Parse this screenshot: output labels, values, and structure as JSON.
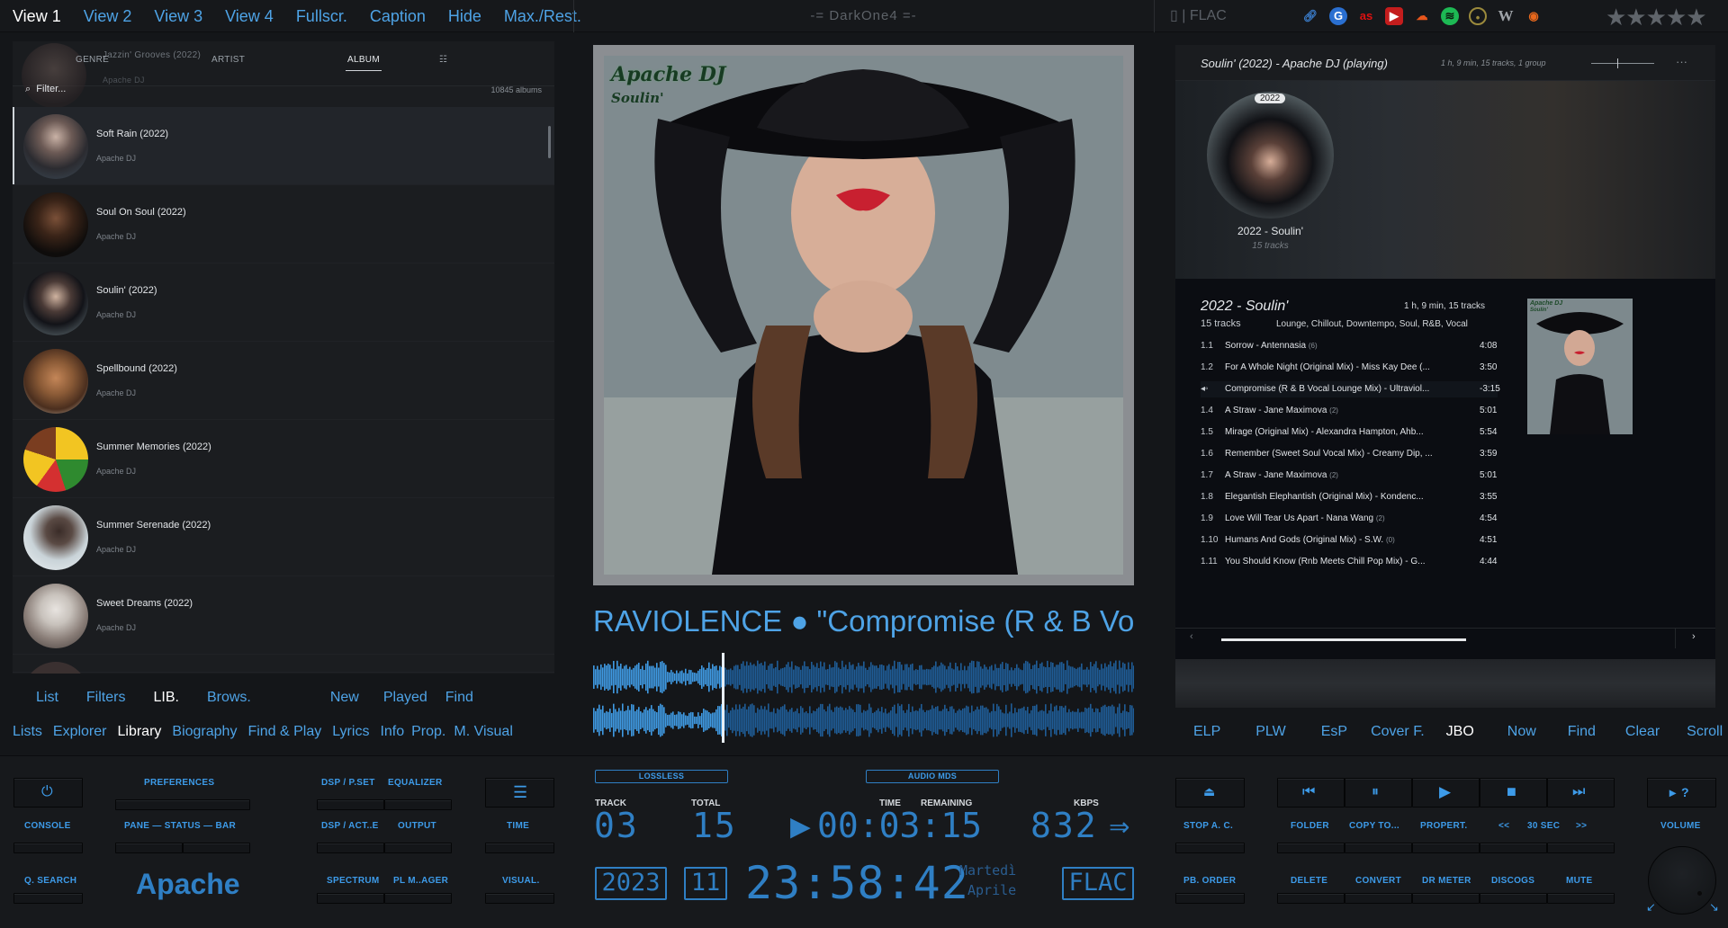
{
  "topbar": {
    "views": [
      "View 1",
      "View 2",
      "View 3",
      "View 4",
      "Fullscr.",
      "Caption",
      "Hide",
      "Max./Rest."
    ],
    "title": "-= DarkOne4 =-",
    "format": "FLAC",
    "icons": [
      "link-icon",
      "google-icon",
      "lastfm-icon",
      "youtube-icon",
      "soundcloud-icon",
      "spotify-icon",
      "target-icon",
      "wikipedia-icon",
      "podcast-icon"
    ],
    "rating_stars": "★★★★★"
  },
  "library": {
    "tabs": {
      "genre": "GENRE",
      "artist": "ARTIST",
      "album": "ALBUM",
      "extra": "☷"
    },
    "peek_title": "Jazzin' Grooves (2022)",
    "peek_sub": "Apache DJ",
    "filter_label": "Filter...",
    "count": "10845 albums",
    "items": [
      {
        "title": "Soft Rain (2022)",
        "artist": "Apache DJ"
      },
      {
        "title": "Soul On Soul (2022)",
        "artist": "Apache DJ"
      },
      {
        "title": "Soulin' (2022)",
        "artist": "Apache DJ"
      },
      {
        "title": "Spellbound (2022)",
        "artist": "Apache DJ"
      },
      {
        "title": "Summer Memories (2022)",
        "artist": "Apache DJ"
      },
      {
        "title": "Summer Serenade (2022)",
        "artist": "Apache DJ"
      },
      {
        "title": "Sweet Dreams (2022)",
        "artist": "Apache DJ"
      }
    ],
    "row1": [
      "List",
      "Filters",
      "LIB.",
      "Brows.",
      "New",
      "Played",
      "Find"
    ],
    "row2": [
      "Lists",
      "Explorer",
      "Library",
      "Biography",
      "Find & Play",
      "Lyrics",
      "Info",
      "Prop.",
      "M. Visual"
    ]
  },
  "cover": {
    "artist": "Apache DJ",
    "album": "Soulin'"
  },
  "nowplaying": "RAVIOLENCE ● \"Compromise (R & B Vocal Lounge Mix)\" ● Soulin'",
  "playlist": {
    "header_title": "Soulin' (2022) - Apache DJ (playing)",
    "header_info": "1 h, 9 min,  15 tracks,  1 group",
    "more": "···",
    "group_year": "2022",
    "group_title": "2022 - Soulin'",
    "group_tracks": "15 tracks",
    "album_title": "2022 - Soulin'",
    "album_info": "1 h, 9 min,  15 tracks",
    "album_count": "15 tracks",
    "genres": "Lounge, Chillout, Downtempo, Soul, R&B, Vocal",
    "tracks": [
      {
        "no": "1.1",
        "title": "Sorrow - Antennasia",
        "count": "(6)",
        "dur": "4:08"
      },
      {
        "no": "1.2",
        "title": "For A Whole Night (Original Mix) - Miss Kay Dee (...",
        "count": "",
        "dur": "3:50"
      },
      {
        "no": "◂◦",
        "title": "Compromise (R & B Vocal Lounge Mix) - Ultraviol...",
        "count": "",
        "dur": "-3:15"
      },
      {
        "no": "1.4",
        "title": "A Straw - Jane Maximova",
        "count": "(2)",
        "dur": "5:01"
      },
      {
        "no": "1.5",
        "title": "Mirage (Original Mix) - Alexandra Hampton, Ahb...",
        "count": "",
        "dur": "5:54"
      },
      {
        "no": "1.6",
        "title": "Remember (Sweet Soul Vocal Mix) - Creamy Dip, ...",
        "count": "",
        "dur": "3:59"
      },
      {
        "no": "1.7",
        "title": "A Straw - Jane Maximova",
        "count": "(2)",
        "dur": "5:01"
      },
      {
        "no": "1.8",
        "title": "Elegantish Elephantish (Original Mix) - Kondenc...",
        "count": "",
        "dur": "3:55"
      },
      {
        "no": "1.9",
        "title": "Love Will Tear Us Apart - Nana Wang",
        "count": "(2)",
        "dur": "4:54"
      },
      {
        "no": "1.10",
        "title": "Humans And Gods (Original Mix) - S.W.",
        "count": "(0)",
        "dur": "4:51"
      },
      {
        "no": "1.11",
        "title": "You Should Know (Rnb Meets Chill Pop Mix) - G...",
        "count": "",
        "dur": "4:44"
      }
    ],
    "row": [
      "ELP",
      "PLW",
      "EsP",
      "Cover F.",
      "JBO",
      "Now",
      "Find",
      "Clear",
      "Scroll"
    ]
  },
  "controls": {
    "console": "CONSOLE",
    "preferences": "PREFERENCES",
    "pane_status_bar": "PANE — STATUS — BAR",
    "dsp_pset": "DSP / P.SET",
    "equalizer": "EQUALIZER",
    "dsp_act": "DSP / ACT..E",
    "output": "OUTPUT",
    "time": "TIME",
    "q_search": "Q. SEARCH",
    "apache": "Apache",
    "spectrum": "SPECTRUM",
    "pl_manager": "PL M..AGER",
    "visual": "VISUAL.",
    "stop_ac": "STOP A. C.",
    "pb_order": "PB. ORDER",
    "folder": "FOLDER",
    "copy_to": "COPY TO...",
    "propert": "PROPERT.",
    "back30": "<<",
    "sec30": "30 SEC",
    "fwd30": ">>",
    "delete": "DELETE",
    "convert": "CONVERT",
    "dr_meter": "DR METER",
    "discogs": "DISCOGS",
    "mute": "MUTE",
    "volume": "VOLUME",
    "help": "?"
  },
  "display": {
    "lossless": "LOSSLESS",
    "audio_mode": "AUDIO MDS",
    "track_label": "TRACK",
    "track": "03",
    "total_label": "TOTAL",
    "total": "15",
    "time_label": "TIME",
    "remaining_label": "REMAINING",
    "time": "00:03:15",
    "kbps_label": "KBPS",
    "kbps": "832",
    "arrow": "⇒",
    "year": "2023",
    "month": "11",
    "clock": "23:58:42",
    "day": "Martedì",
    "monthname": "Aprile",
    "codec": "FLAC"
  },
  "colors": {
    "accent": "#4ea3e6",
    "lcd": "#2f7fc4",
    "bg": "#141619"
  }
}
